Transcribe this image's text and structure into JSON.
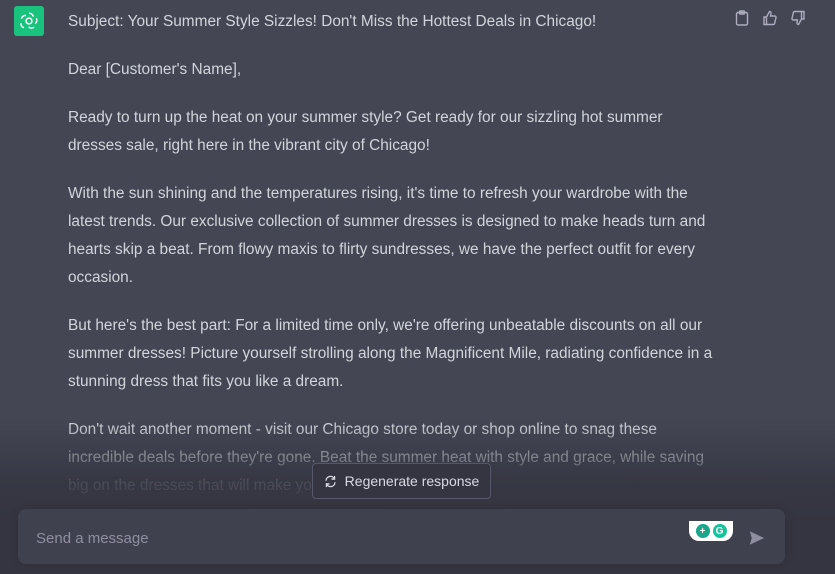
{
  "message": {
    "subject": "Subject: Your Summer Style Sizzles! Don't Miss the Hottest Deals in Chicago!",
    "greeting": "Dear [Customer's Name],",
    "paragraphs": [
      "Ready to turn up the heat on your summer style? Get ready for our sizzling hot summer dresses sale, right here in the vibrant city of Chicago!",
      "With the sun shining and the temperatures rising, it's time to refresh your wardrobe with the latest trends. Our exclusive collection of summer dresses is designed to make heads turn and hearts skip a beat. From flowy maxis to flirty sundresses, we have the perfect outfit for every occasion.",
      "But here's the best part: For a limited time only, we're offering unbeatable discounts on all our summer dresses! Picture yourself strolling along the Magnificent Mile, radiating confidence in a stunning dress that fits you like a dream.",
      "Don't wait another moment - visit our Chicago store today or shop online to snag these incredible deals before they're gone. Beat the summer heat with style and grace, while saving big on the dresses that will make you stand out in the city."
    ]
  },
  "actions": {
    "copy_icon": "clipboard-icon",
    "like_icon": "thumbs-up-icon",
    "dislike_icon": "thumbs-down-icon"
  },
  "regenerate": {
    "label": "Regenerate response",
    "icon": "refresh-icon"
  },
  "composer": {
    "placeholder": "Send a message",
    "value": "",
    "send_icon": "send-icon"
  },
  "colors": {
    "background": "#444654",
    "avatar": "#19c37d",
    "composer": "#40414f",
    "text": "#d1d5db"
  }
}
